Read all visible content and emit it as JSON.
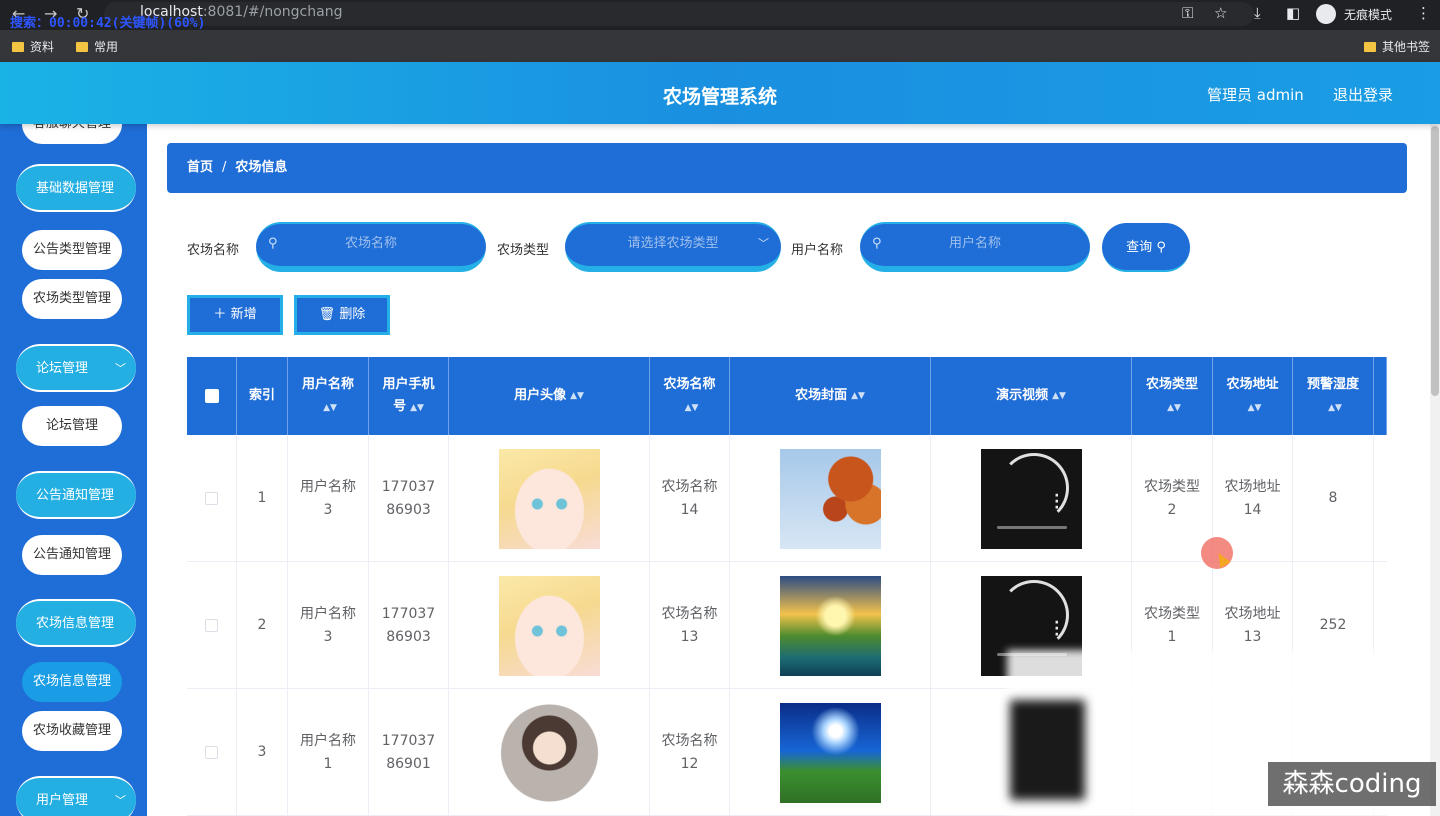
{
  "browser": {
    "url_host": "localhost",
    "url_rest": ":8081/#/nongchang",
    "search_overlay": "搜索：00:00:42(关键帧)(60%)",
    "incognito_label": "无痕模式",
    "bookmarks": [
      "资料",
      "常用"
    ],
    "other_bookmarks": "其他书签"
  },
  "header": {
    "title": "农场管理系统",
    "user": "管理员 admin",
    "logout": "退出登录"
  },
  "sidebar": {
    "partial_top": "客服聊天管理",
    "groups": [
      {
        "label": "基础数据管理",
        "items": [
          "公告类型管理",
          "农场类型管理"
        ]
      },
      {
        "label": "论坛管理",
        "items": [
          "论坛管理"
        ]
      },
      {
        "label": "公告通知管理",
        "items": [
          "公告通知管理"
        ]
      },
      {
        "label": "农场信息管理",
        "items": [
          "农场信息管理",
          "农场收藏管理"
        ]
      },
      {
        "label": "用户管理",
        "items": []
      }
    ]
  },
  "breadcrumb": {
    "home": "首页",
    "sep": "/",
    "current": "农场信息"
  },
  "search": {
    "farm_name_label": "农场名称",
    "farm_name_placeholder": "农场名称",
    "farm_type_label": "农场类型",
    "farm_type_placeholder": "请选择农场类型",
    "user_name_label": "用户名称",
    "user_name_placeholder": "用户名称",
    "query_button": "查询"
  },
  "actions": {
    "add": "新增",
    "delete": "删除"
  },
  "table": {
    "columns": [
      "索引",
      "用户名称",
      "用户手机号",
      "用户头像",
      "农场名称",
      "农场封面",
      "演示视频",
      "农场类型",
      "农场地址",
      "预警湿度"
    ],
    "rows": [
      {
        "index": "1",
        "user_name": "用户名称3",
        "phone": "17703786903",
        "avatar": "anime-girl",
        "farm_name": "农场名称14",
        "cover": "autumn-leaves",
        "farm_type": "农场类型2",
        "address": "农场地址14",
        "humidity": "8"
      },
      {
        "index": "2",
        "user_name": "用户名称3",
        "phone": "17703786903",
        "avatar": "anime-girl",
        "farm_name": "农场名称13",
        "cover": "sunset-lake",
        "farm_type": "农场类型1",
        "address": "农场地址13",
        "humidity": "252"
      },
      {
        "index": "3",
        "user_name": "用户名称1",
        "phone": "17703786901",
        "avatar": "portrait-girl",
        "farm_name": "农场名称12",
        "cover": "sky-field",
        "farm_type": "",
        "address": "",
        "humidity": ""
      }
    ]
  },
  "watermark": "森森coding",
  "colors": {
    "primary": "#1f6dd6",
    "accent": "#24b0e6",
    "header": "#1a9de4"
  }
}
